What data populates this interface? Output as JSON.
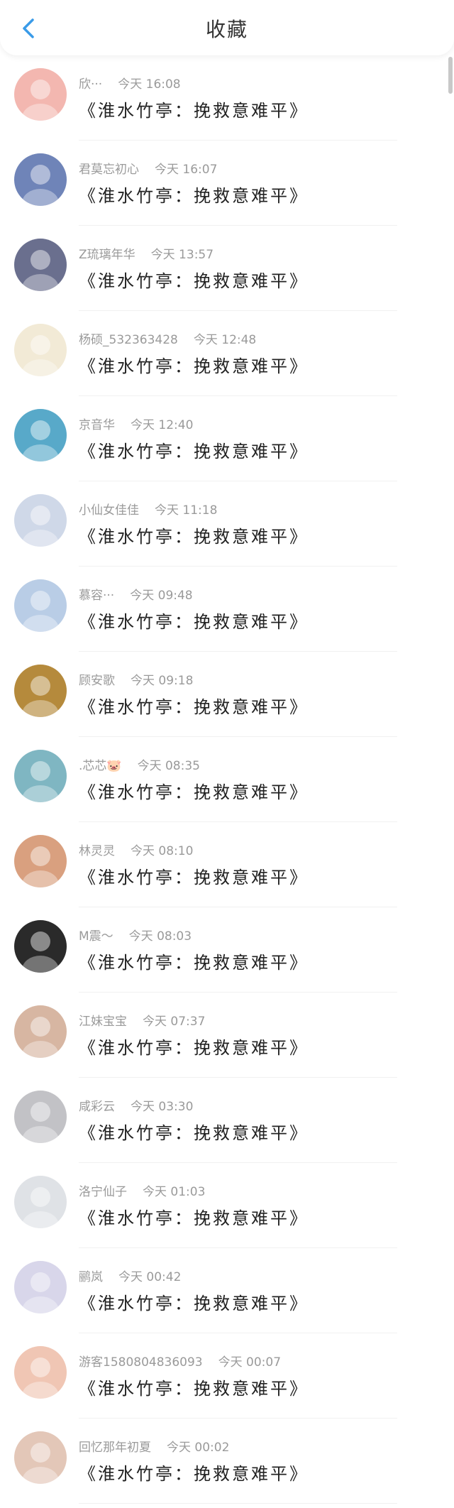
{
  "header": {
    "title": "收藏",
    "back_icon": "chevron-left-icon",
    "accent_color": "#3a9be8"
  },
  "items": [
    {
      "name": "欣···",
      "time": "今天 16:08",
      "content": "《淮水竹亭：挽救意难平》",
      "avatar_color": "#f3b7b0"
    },
    {
      "name": "君莫忘初心",
      "time": "今天 16:07",
      "content": "《淮水竹亭：挽救意难平》",
      "avatar_color": "#6f84b8"
    },
    {
      "name": "Z琉璃年华",
      "time": "今天 13:57",
      "content": "《淮水竹亭：挽救意难平》",
      "avatar_color": "#6a6f8e"
    },
    {
      "name": "杨硕_532363428",
      "time": "今天 12:48",
      "content": "《淮水竹亭：挽救意难平》",
      "avatar_color": "#f2ead6"
    },
    {
      "name": "京音华",
      "time": "今天 12:40",
      "content": "《淮水竹亭：挽救意难平》",
      "avatar_color": "#58a9c9"
    },
    {
      "name": "小仙女佳佳",
      "time": "今天 11:18",
      "content": "《淮水竹亭：挽救意难平》",
      "avatar_color": "#cfd8e8"
    },
    {
      "name": "慕容···",
      "time": "今天 09:48",
      "content": "《淮水竹亭：挽救意难平》",
      "avatar_color": "#b9cde6"
    },
    {
      "name": "顾安歌",
      "time": "今天 09:18",
      "content": "《淮水竹亭：挽救意难平》",
      "avatar_color": "#b58a3c"
    },
    {
      "name": ".芯芯🐷",
      "time": "今天 08:35",
      "content": "《淮水竹亭：挽救意难平》",
      "avatar_color": "#7fb6c2"
    },
    {
      "name": "林灵灵",
      "time": "今天 08:10",
      "content": "《淮水竹亭：挽救意难平》",
      "avatar_color": "#d9a07f"
    },
    {
      "name": "M震～",
      "time": "今天 08:03",
      "content": "《淮水竹亭：挽救意难平》",
      "avatar_color": "#2a2a2a"
    },
    {
      "name": "江妹宝宝",
      "time": "今天 07:37",
      "content": "《淮水竹亭：挽救意难平》",
      "avatar_color": "#d7b6a2"
    },
    {
      "name": "咸彩云",
      "time": "今天 03:30",
      "content": "《淮水竹亭：挽救意难平》",
      "avatar_color": "#c2c2c6"
    },
    {
      "name": "洛宁仙子",
      "time": "今天 01:03",
      "content": "《淮水竹亭：挽救意难平》",
      "avatar_color": "#dfe2e6"
    },
    {
      "name": "鹂岚",
      "time": "今天 00:42",
      "content": "《淮水竹亭：挽救意难平》",
      "avatar_color": "#d8d6ea"
    },
    {
      "name": "游客15808048360​93",
      "time": "今天 00:07",
      "content": "《淮水竹亭：挽救意难平》",
      "avatar_color": "#f0c6b4"
    },
    {
      "name": "回忆那年初夏",
      "time": "今天 00:02",
      "content": "《淮水竹亭：挽救意难平》",
      "avatar_color": "#e3c7b8"
    }
  ]
}
